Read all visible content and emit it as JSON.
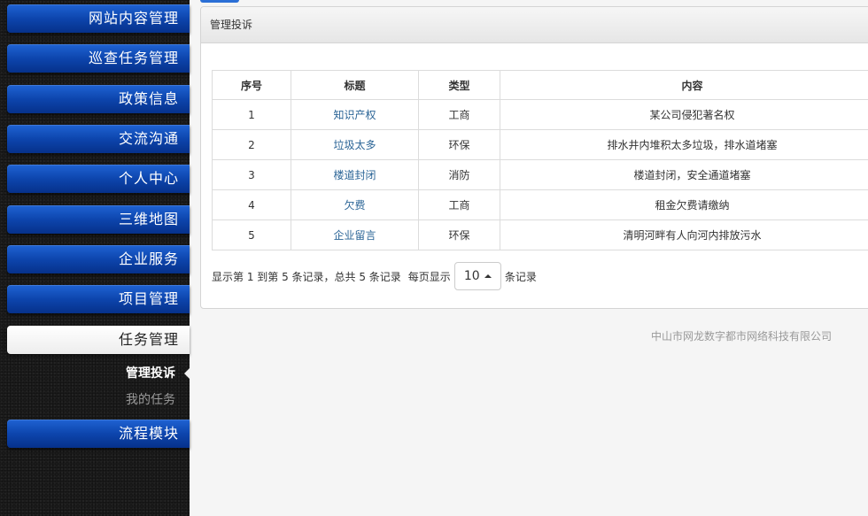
{
  "sidebar": {
    "items": [
      {
        "label": "网站内容管理"
      },
      {
        "label": "巡查任务管理"
      },
      {
        "label": "政策信息"
      },
      {
        "label": "交流沟通"
      },
      {
        "label": "个人中心"
      },
      {
        "label": "三维地图"
      },
      {
        "label": "企业服务"
      },
      {
        "label": "项目管理"
      },
      {
        "label": "任务管理"
      },
      {
        "label": "流程模块"
      }
    ],
    "subitems": [
      {
        "label": "管理投诉"
      },
      {
        "label": "我的任务"
      }
    ]
  },
  "panel": {
    "title": "管理投诉",
    "table": {
      "headers": [
        "序号",
        "标题",
        "类型",
        "内容"
      ],
      "rows": [
        [
          "1",
          "知识产权",
          "工商",
          "某公司侵犯著名权"
        ],
        [
          "2",
          "垃圾太多",
          "环保",
          "排水井内堆积太多垃圾，排水道堵塞"
        ],
        [
          "3",
          "楼道封闭",
          "消防",
          "楼道封闭，安全通道堵塞"
        ],
        [
          "4",
          "欠费",
          "工商",
          "租金欠费请缴纳"
        ],
        [
          "5",
          "企业留言",
          "环保",
          "清明河畔有人向河内排放污水"
        ]
      ]
    },
    "pager": {
      "summary": "显示第 1 到第 5 条记录，总共 5 条记录",
      "per_page_label": "每页显示",
      "page_size": "10",
      "records_suffix": "条记录"
    }
  },
  "footer": {
    "company": "中山市网龙数字都市网络科技有限公司"
  }
}
